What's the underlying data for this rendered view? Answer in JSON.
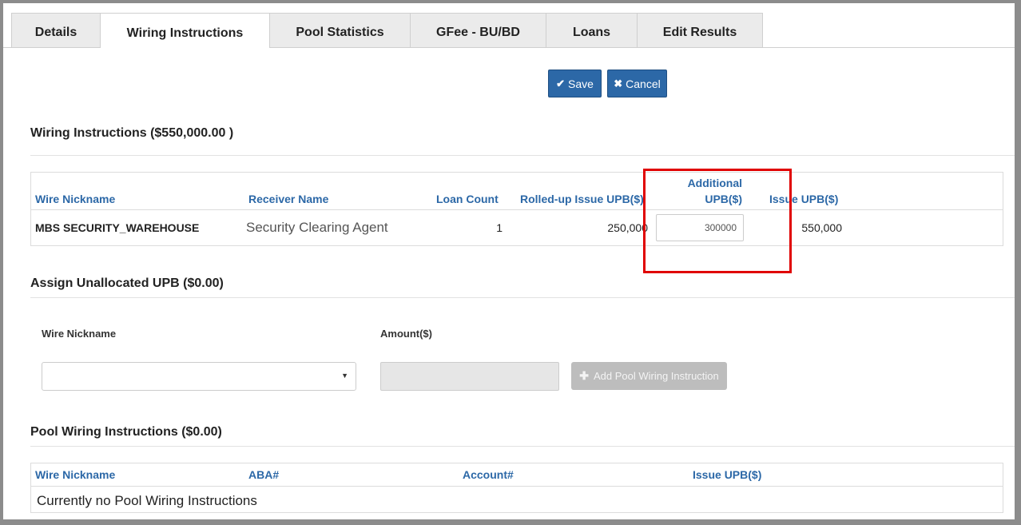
{
  "tabs": [
    "Details",
    "Wiring Instructions",
    "Pool Statistics",
    "GFee - BU/BD",
    "Loans",
    "Edit Results"
  ],
  "buttons": {
    "save": "Save",
    "cancel": "Cancel"
  },
  "wiring": {
    "title": "Wiring Instructions ($550,000.00 )",
    "headers": {
      "wire_nickname": "Wire Nickname",
      "receiver_name": "Receiver Name",
      "loan_count": "Loan Count",
      "rolled_up": "Rolled-up Issue UPB($)",
      "additional_1": "Additional",
      "additional_2": "UPB($)",
      "issue_upb": "Issue UPB($)"
    },
    "row": {
      "wire_nickname": "MBS SECURITY_WAREHOUSE",
      "receiver_name": "Security Clearing Agent",
      "loan_count": "1",
      "rolled_up": "250,000",
      "additional_value": "300000",
      "issue_upb": "550,000"
    }
  },
  "assign": {
    "title": "Assign Unallocated UPB ($0.00)",
    "wire_nickname_label": "Wire Nickname",
    "amount_label": "Amount($)",
    "add_button": "Add Pool Wiring Instruction"
  },
  "pool": {
    "title": "Pool Wiring Instructions ($0.00)",
    "headers": {
      "wire_nickname": "Wire Nickname",
      "aba": "ABA#",
      "account": "Account#",
      "issue_upb": "Issue UPB($)"
    },
    "empty_text": "Currently no Pool Wiring Instructions"
  },
  "colors": {
    "primary": "#2c68a7",
    "highlight": "#e00000",
    "disabled": "#bdbdbd"
  }
}
